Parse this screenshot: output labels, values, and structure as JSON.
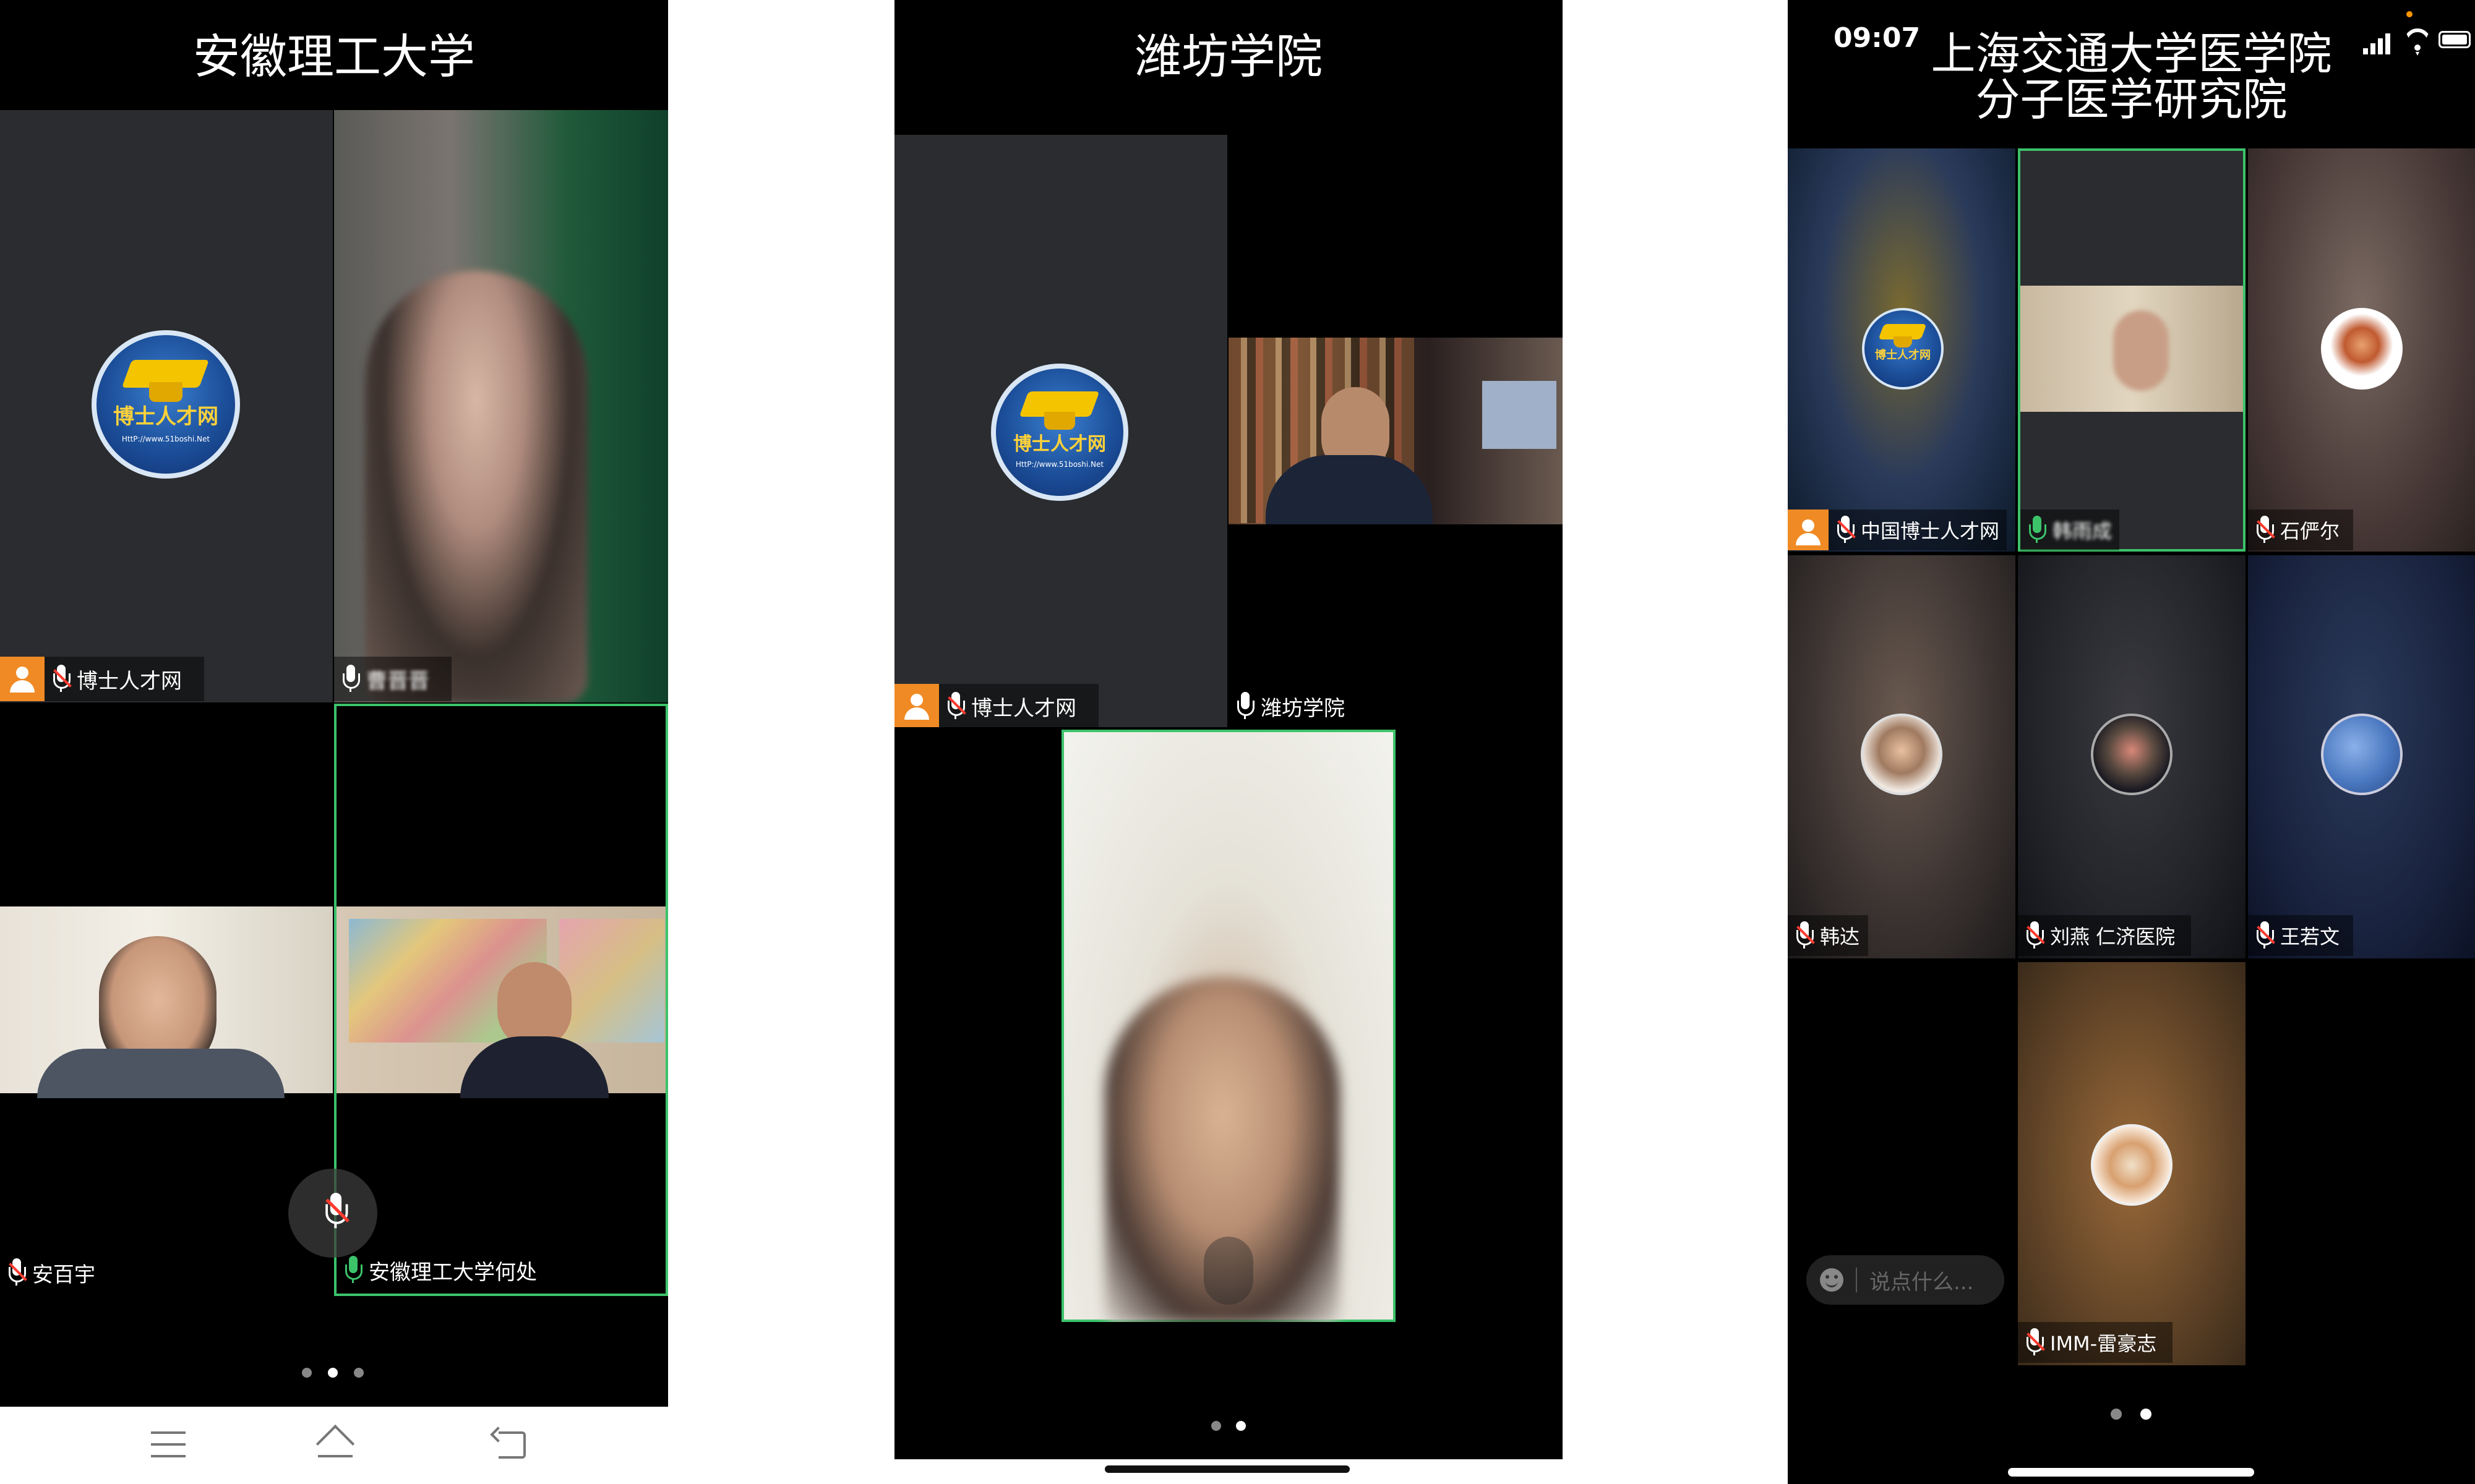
{
  "panel1": {
    "title": "安徽理工大学",
    "labels": [
      "博士人才网",
      "曹晋晋",
      "安百宇",
      "安徽理工大学何处"
    ]
  },
  "panel2": {
    "title": "潍坊学院",
    "labels": [
      "博士人才网",
      "潍坊学院"
    ]
  },
  "panel3": {
    "status_time": "09:07",
    "title_line1": "上海交通大学医学院",
    "title_line2": "分子医学研究院",
    "labels": [
      "中国博士人才网",
      "韩雨成",
      "石俨尔",
      "韩达",
      "刘燕 仁济医院",
      "王若文",
      "IMM-雷豪志"
    ],
    "chat_placeholder": "说点什么..."
  },
  "logo_text": "博士人才网",
  "logo_url": "HttP://www.51boshi.Net",
  "colors": {
    "accent_green": "#3cc36a",
    "host_orange": "#f08a24",
    "mute_red": "#ff3b30"
  }
}
